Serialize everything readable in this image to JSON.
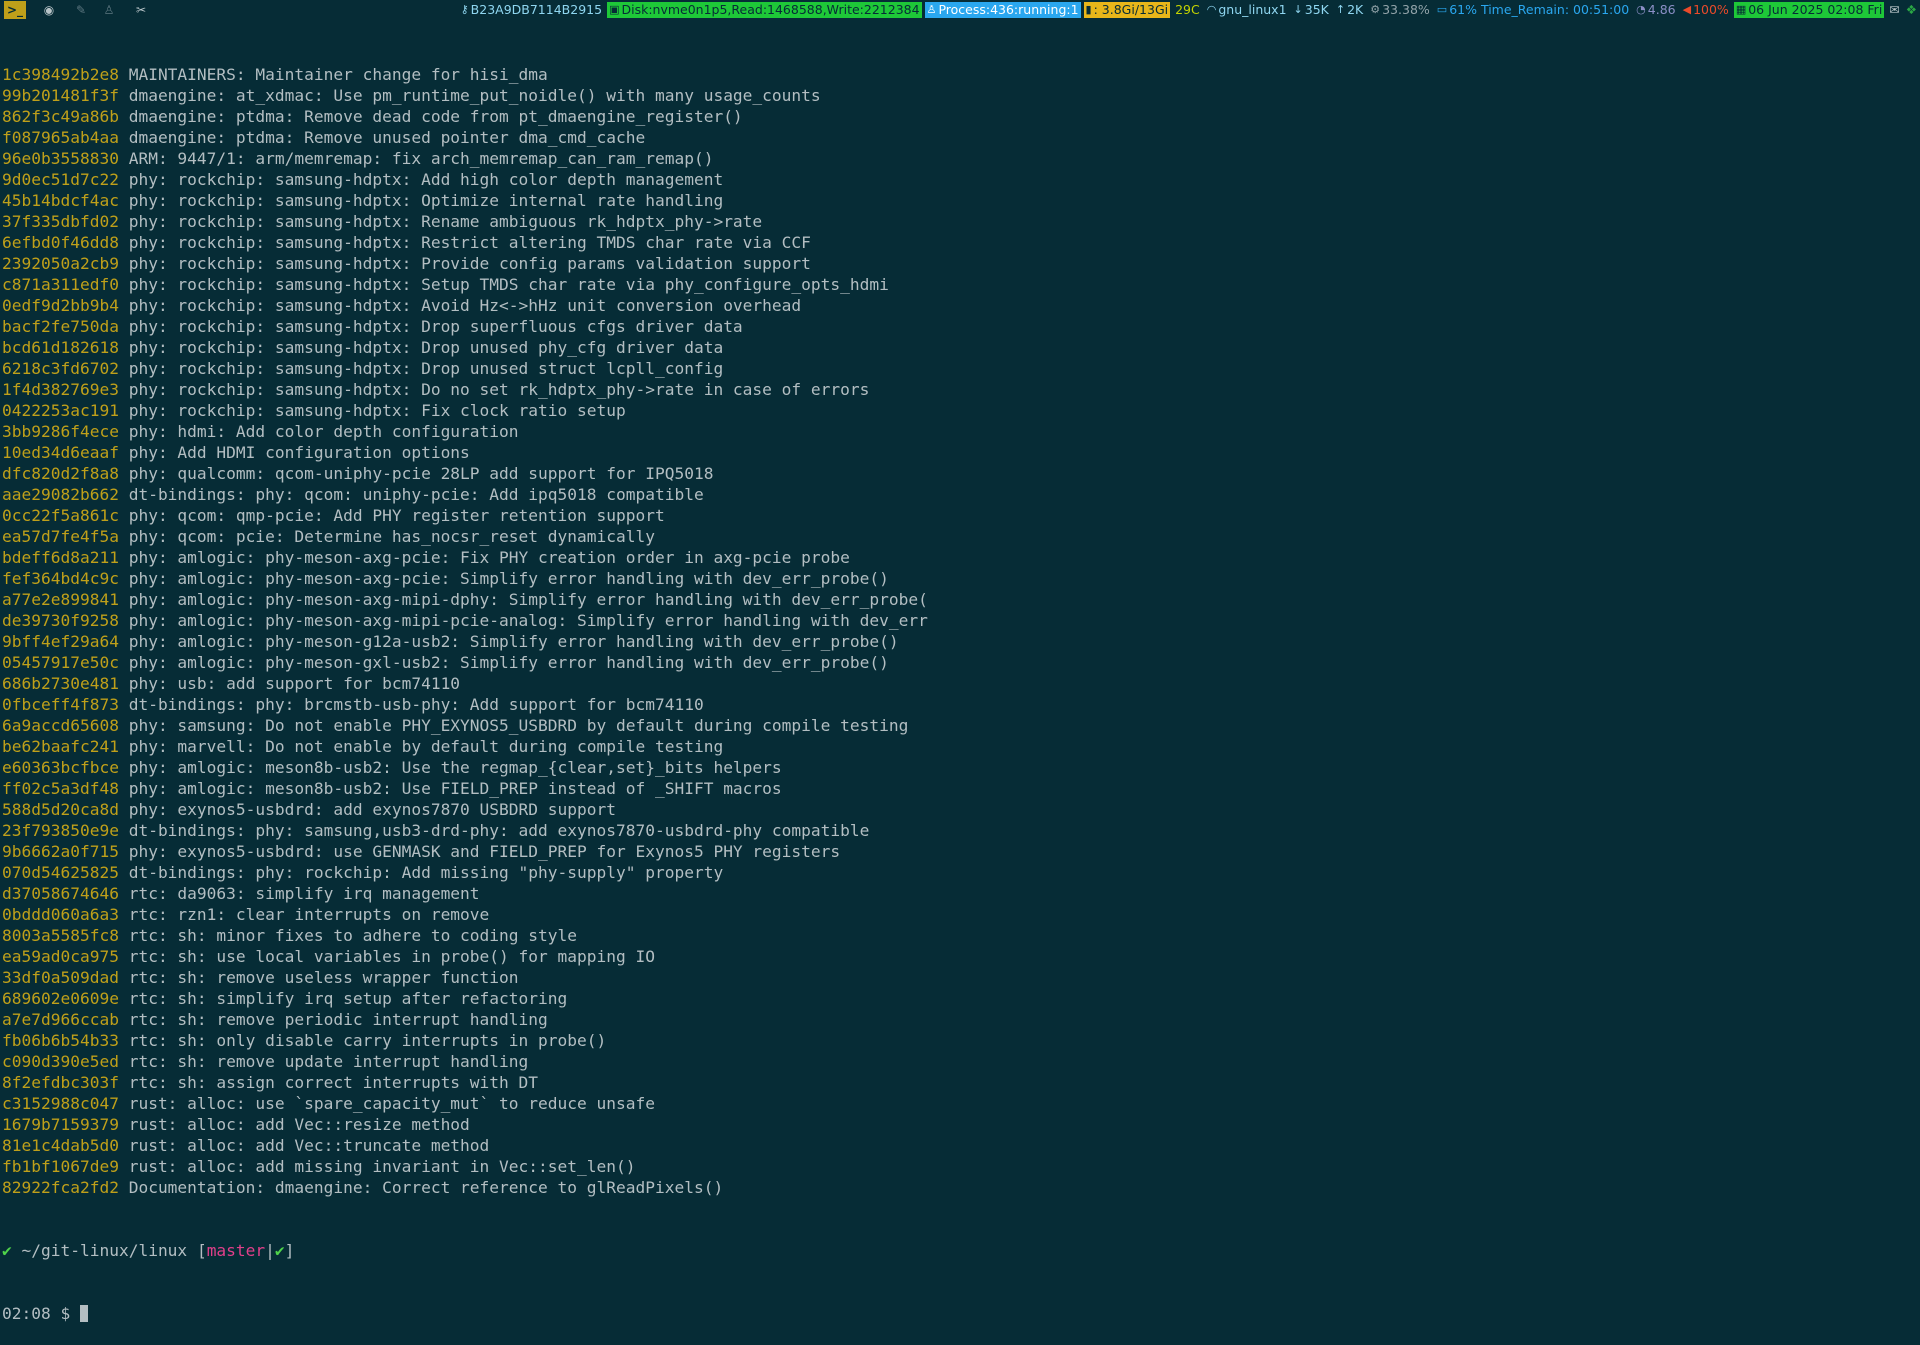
{
  "statusbar": {
    "workspaces": [
      {
        "icon": "terminal-icon",
        "glyph": ">_"
      },
      {
        "icon": "browser-icon",
        "glyph": "◉"
      },
      {
        "icon": "editor-icon",
        "glyph": "✎"
      },
      {
        "icon": "penguin-icon",
        "glyph": "♙"
      },
      {
        "icon": "tools-icon",
        "glyph": "✂"
      }
    ],
    "host": "B23A9DB7114B2915",
    "disk": "Disk:nvme0n1p5,Read:1468588,Write:2212384",
    "process": "Process:436:running:1",
    "memory": ": 3.8Gi/13Gi",
    "temperature": "29C",
    "network": "gnu_linux1",
    "download": "35K",
    "upload": "2K",
    "cpu": "33.38%",
    "battery": "61% Time_Remain: 00:51:00",
    "load": "4.86",
    "volume": "100%",
    "datetime": "06 Jun 2025 02:08 Fri",
    "colors": {
      "disk": "#1ec838",
      "process": "#2aa7ef",
      "memory": "#e8b61a",
      "date": "#1ec838",
      "volume": "#ea4a2a"
    }
  },
  "terminal": {
    "log": [
      {
        "hash": "1c398492b2e8",
        "msg": "MAINTAINERS: Maintainer change for hisi_dma"
      },
      {
        "hash": "99b201481f3f",
        "msg": "dmaengine: at_xdmac: Use pm_runtime_put_noidle() with many usage_counts"
      },
      {
        "hash": "862f3c49a86b",
        "msg": "dmaengine: ptdma: Remove dead code from pt_dmaengine_register()"
      },
      {
        "hash": "f087965ab4aa",
        "msg": "dmaengine: ptdma: Remove unused pointer dma_cmd_cache"
      },
      {
        "hash": "96e0b3558830",
        "msg": "ARM: 9447/1: arm/memremap: fix arch_memremap_can_ram_remap()"
      },
      {
        "hash": "9d0ec51d7c22",
        "msg": "phy: rockchip: samsung-hdptx: Add high color depth management"
      },
      {
        "hash": "45b14bdcf4ac",
        "msg": "phy: rockchip: samsung-hdptx: Optimize internal rate handling"
      },
      {
        "hash": "37f335dbfd02",
        "msg": "phy: rockchip: samsung-hdptx: Rename ambiguous rk_hdptx_phy->rate"
      },
      {
        "hash": "6efbd0f46dd8",
        "msg": "phy: rockchip: samsung-hdptx: Restrict altering TMDS char rate via CCF"
      },
      {
        "hash": "2392050a2cb9",
        "msg": "phy: rockchip: samsung-hdptx: Provide config params validation support"
      },
      {
        "hash": "c871a311edf0",
        "msg": "phy: rockchip: samsung-hdptx: Setup TMDS char rate via phy_configure_opts_hdmi"
      },
      {
        "hash": "0edf9d2bb9b4",
        "msg": "phy: rockchip: samsung-hdptx: Avoid Hz<->hHz unit conversion overhead"
      },
      {
        "hash": "bacf2fe750da",
        "msg": "phy: rockchip: samsung-hdptx: Drop superfluous cfgs driver data"
      },
      {
        "hash": "bcd61d182618",
        "msg": "phy: rockchip: samsung-hdptx: Drop unused phy_cfg driver data"
      },
      {
        "hash": "6218c3fd6702",
        "msg": "phy: rockchip: samsung-hdptx: Drop unused struct lcpll_config"
      },
      {
        "hash": "1f4d382769e3",
        "msg": "phy: rockchip: samsung-hdptx: Do no set rk_hdptx_phy->rate in case of errors"
      },
      {
        "hash": "0422253ac191",
        "msg": "phy: rockchip: samsung-hdptx: Fix clock ratio setup"
      },
      {
        "hash": "3bb9286f4ece",
        "msg": "phy: hdmi: Add color depth configuration"
      },
      {
        "hash": "10ed34d6eaaf",
        "msg": "phy: Add HDMI configuration options"
      },
      {
        "hash": "dfc820d2f8a8",
        "msg": "phy: qualcomm: qcom-uniphy-pcie 28LP add support for IPQ5018"
      },
      {
        "hash": "aae29082b662",
        "msg": "dt-bindings: phy: qcom: uniphy-pcie: Add ipq5018 compatible"
      },
      {
        "hash": "0cc22f5a861c",
        "msg": "phy: qcom: qmp-pcie: Add PHY register retention support"
      },
      {
        "hash": "ea57d7fe4f5a",
        "msg": "phy: qcom: pcie: Determine has_nocsr_reset dynamically"
      },
      {
        "hash": "bdeff6d8a211",
        "msg": "phy: amlogic: phy-meson-axg-pcie: Fix PHY creation order in axg-pcie probe"
      },
      {
        "hash": "fef364bd4c9c",
        "msg": "phy: amlogic: phy-meson-axg-pcie: Simplify error handling with dev_err_probe()"
      },
      {
        "hash": "a77e2e899841",
        "msg": "phy: amlogic: phy-meson-axg-mipi-dphy: Simplify error handling with dev_err_probe("
      },
      {
        "hash": "de39730f9258",
        "msg": "phy: amlogic: phy-meson-axg-mipi-pcie-analog: Simplify error handling with dev_err"
      },
      {
        "hash": "9bff4ef29a64",
        "msg": "phy: amlogic: phy-meson-g12a-usb2: Simplify error handling with dev_err_probe()"
      },
      {
        "hash": "05457917e50c",
        "msg": "phy: amlogic: phy-meson-gxl-usb2: Simplify error handling with dev_err_probe()"
      },
      {
        "hash": "686b2730e481",
        "msg": "phy: usb: add support for bcm74110"
      },
      {
        "hash": "0fbceff4f873",
        "msg": "dt-bindings: phy: brcmstb-usb-phy: Add support for bcm74110"
      },
      {
        "hash": "6a9accd65608",
        "msg": "phy: samsung: Do not enable PHY_EXYNOS5_USBDRD by default during compile testing"
      },
      {
        "hash": "be62baafc241",
        "msg": "phy: marvell: Do not enable by default during compile testing"
      },
      {
        "hash": "e60363bcfbce",
        "msg": "phy: amlogic: meson8b-usb2: Use the regmap_{clear,set}_bits helpers"
      },
      {
        "hash": "ff02c5a3df48",
        "msg": "phy: amlogic: meson8b-usb2: Use FIELD_PREP instead of _SHIFT macros"
      },
      {
        "hash": "588d5d20ca8d",
        "msg": "phy: exynos5-usbdrd: add exynos7870 USBDRD support"
      },
      {
        "hash": "23f793850e9e",
        "msg": "dt-bindings: phy: samsung,usb3-drd-phy: add exynos7870-usbdrd-phy compatible"
      },
      {
        "hash": "9b6662a0f715",
        "msg": "phy: exynos5-usbdrd: use GENMASK and FIELD_PREP for Exynos5 PHY registers"
      },
      {
        "hash": "070d54625825",
        "msg": "dt-bindings: phy: rockchip: Add missing \"phy-supply\" property"
      },
      {
        "hash": "d37058674646",
        "msg": "rtc: da9063: simplify irq management"
      },
      {
        "hash": "0bddd060a6a3",
        "msg": "rtc: rzn1: clear interrupts on remove"
      },
      {
        "hash": "8003a5585fc8",
        "msg": "rtc: sh: minor fixes to adhere to coding style"
      },
      {
        "hash": "ea59ad0ca975",
        "msg": "rtc: sh: use local variables in probe() for mapping IO"
      },
      {
        "hash": "33df0a509dad",
        "msg": "rtc: sh: remove useless wrapper function"
      },
      {
        "hash": "689602e0609e",
        "msg": "rtc: sh: simplify irq setup after refactoring"
      },
      {
        "hash": "a7e7d966ccab",
        "msg": "rtc: sh: remove periodic interrupt handling"
      },
      {
        "hash": "fb06b6b54b33",
        "msg": "rtc: sh: only disable carry interrupts in probe()"
      },
      {
        "hash": "c090d390e5ed",
        "msg": "rtc: sh: remove update interrupt handling"
      },
      {
        "hash": "8f2efdbc303f",
        "msg": "rtc: sh: assign correct interrupts with DT"
      },
      {
        "hash": "c3152988c047",
        "msg": "rust: alloc: use `spare_capacity_mut` to reduce unsafe"
      },
      {
        "hash": "1679b7159379",
        "msg": "rust: alloc: add Vec::resize method"
      },
      {
        "hash": "81e1c4dab5d0",
        "msg": "rust: alloc: add Vec::truncate method"
      },
      {
        "hash": "fb1bf1067de9",
        "msg": "rust: alloc: add missing invariant in Vec::set_len()"
      },
      {
        "hash": "82922fca2fd2",
        "msg": "Documentation: dmaengine: Correct reference to glReadPixels()"
      }
    ],
    "prompt": {
      "check": "✔",
      "path": "~/git-linux/linux",
      "bracket_open": "[",
      "branch": "master",
      "separator": "|",
      "status": "✔",
      "bracket_close": "]",
      "time": "02:08",
      "symbol": "$"
    }
  }
}
